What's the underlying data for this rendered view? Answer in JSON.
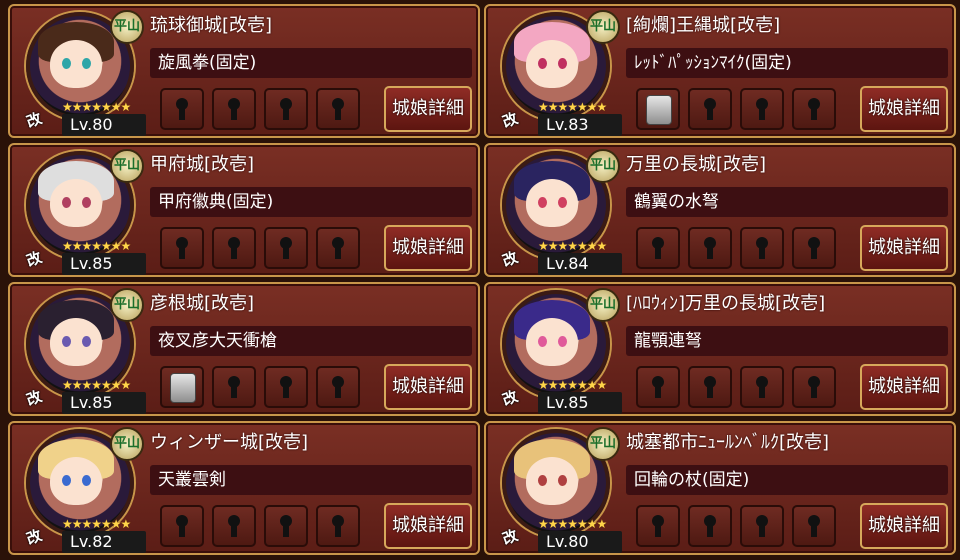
{
  "colors": {
    "card_bg": "#7a2f24",
    "border": "#c8964a",
    "skill_bg": "#3d0f12",
    "star": "#ffd54a"
  },
  "cards": [
    {
      "name": "琉球御城[改壱]",
      "skill": "旋風拳(固定)",
      "level": "Lv.80",
      "stars": "★★★★★★★",
      "type": "平山",
      "kai": "改",
      "detail": "城娘詳細",
      "slots": [
        "lock",
        "lock",
        "lock",
        "lock"
      ],
      "hair": "#4a2a1a",
      "eye": "#2fa6a8"
    },
    {
      "name": "[絢爛]王縄城[改壱]",
      "skill": "ﾚｯﾄﾞﾊﾟｯｼｮﾝﾏｲｸ(固定)",
      "level": "Lv.83",
      "stars": "★★★★★★★",
      "type": "平山",
      "kai": "改",
      "detail": "城娘詳細",
      "slots": [
        "item",
        "lock",
        "lock",
        "lock"
      ],
      "hair": "#f3a7c2",
      "eye": "#c03060"
    },
    {
      "name": "甲府城[改壱]",
      "skill": "甲府徽典(固定)",
      "level": "Lv.85",
      "stars": "★★★★★★★",
      "type": "平山",
      "kai": "改",
      "detail": "城娘詳細",
      "slots": [
        "lock",
        "lock",
        "lock",
        "lock"
      ],
      "hair": "#dedede",
      "eye": "#b04060"
    },
    {
      "name": "万里の長城[改壱]",
      "skill": "鶴翼の水弩",
      "level": "Lv.84",
      "stars": "★★★★★★★",
      "type": "平山",
      "kai": "改",
      "detail": "城娘詳細",
      "slots": [
        "lock",
        "lock",
        "lock",
        "lock"
      ],
      "hair": "#2a2460",
      "eye": "#d04060"
    },
    {
      "name": "彦根城[改壱]",
      "skill": "夜叉彦大天衝槍",
      "level": "Lv.85",
      "stars": "★★★★★★★",
      "type": "平山",
      "kai": "改",
      "detail": "城娘詳細",
      "slots": [
        "item",
        "lock",
        "lock",
        "lock"
      ],
      "hair": "#2a2030",
      "eye": "#6a5ab0"
    },
    {
      "name": "[ﾊﾛｳｨﾝ]万里の長城[改壱]",
      "skill": "龍顎連弩",
      "level": "Lv.85",
      "stars": "★★★★★★★",
      "type": "平山",
      "kai": "改",
      "detail": "城娘詳細",
      "slots": [
        "lock",
        "lock",
        "lock",
        "lock"
      ],
      "hair": "#3a2a8a",
      "eye": "#e05a9a"
    },
    {
      "name": "ウィンザー城[改壱]",
      "skill": "天叢雲剣",
      "level": "Lv.82",
      "stars": "★★★★★★★",
      "type": "平山",
      "kai": "改",
      "detail": "城娘詳細",
      "slots": [
        "lock",
        "lock",
        "lock",
        "lock"
      ],
      "hair": "#f0d28a",
      "eye": "#3a6ad0"
    },
    {
      "name": "城塞都市ﾆｭｰﾙﾝﾍﾞﾙｸ[改壱]",
      "skill": "回輪の杖(固定)",
      "level": "Lv.80",
      "stars": "★★★★★★★",
      "type": "平山",
      "kai": "改",
      "detail": "城娘詳細",
      "slots": [
        "lock",
        "lock",
        "lock",
        "lock"
      ],
      "hair": "#e8c27a",
      "eye": "#b04040"
    }
  ]
}
